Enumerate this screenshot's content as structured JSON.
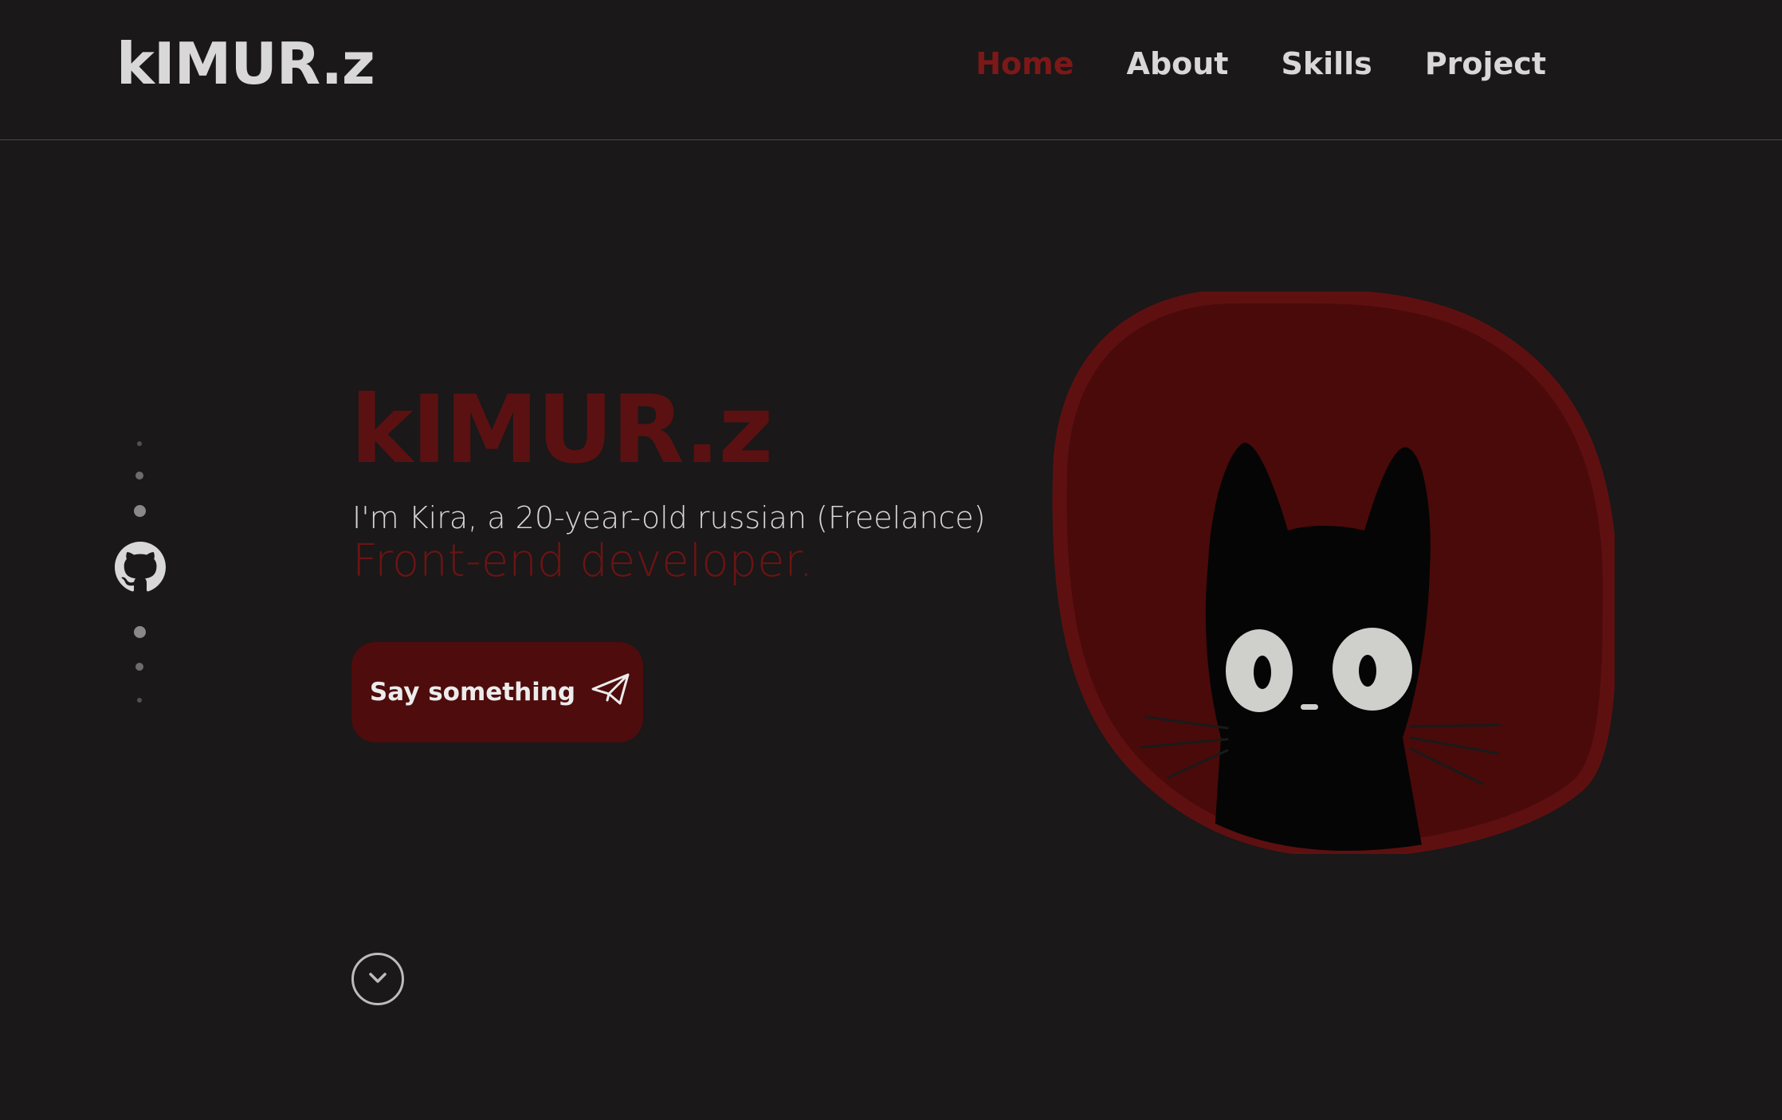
{
  "header": {
    "logo": "kIMUR.z",
    "nav": [
      {
        "label": "Home",
        "active": true
      },
      {
        "label": "About",
        "active": false
      },
      {
        "label": "Skills",
        "active": false
      },
      {
        "label": "Project",
        "active": false
      }
    ]
  },
  "hero": {
    "name": "kIMUR.z",
    "intro": "I'm Kira, a 20-year-old russian (Freelance)",
    "role": "Front-end developer.",
    "cta_label": "Say something"
  },
  "colors": {
    "background": "#1a1819",
    "accent": "#7d1818",
    "button": "#4e0c0c",
    "blob": "#4a0a0a",
    "blob_border": "#5e1010"
  },
  "icons": {
    "social": "github-icon",
    "cta": "paper-plane-icon",
    "scroll": "chevron-down-icon",
    "avatar": "black-cat-avatar"
  }
}
